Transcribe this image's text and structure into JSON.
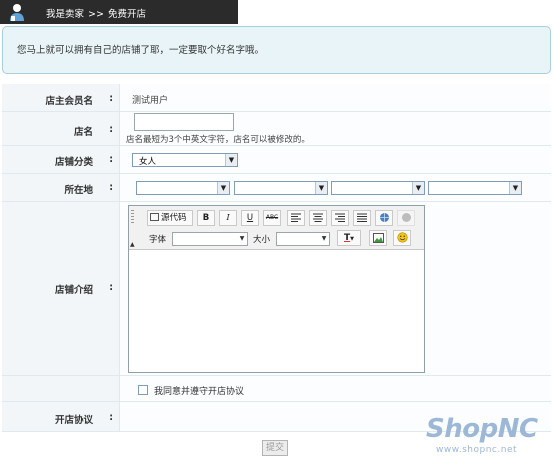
{
  "header": {
    "role": "我是卖家",
    "separator": ">>",
    "page": "免费开店"
  },
  "notice": "您马上就可以拥有自己的店铺了耶，一定要取个好名字哦。",
  "form": {
    "owner": {
      "label": "店主会员名",
      "value": "测试用户"
    },
    "store_name": {
      "label": "店名",
      "value": "",
      "hint": "店名最短为3个中英文字符，店名可以被修改的。"
    },
    "category": {
      "label": "店铺分类",
      "selected": "女人"
    },
    "location": {
      "label": "所在地",
      "selects": [
        "",
        "",
        "",
        ""
      ]
    },
    "intro": {
      "label": "店铺介绍",
      "toolbar": {
        "source_label": "源代码",
        "bold": "B",
        "italic": "I",
        "underline": "U",
        "strike": "ABC",
        "font_label": "字体",
        "size_label": "大小",
        "font_value": "",
        "size_value": ""
      },
      "content": ""
    },
    "agree_label": "我同意并遵守开店协议",
    "agreement_label": "开店协议"
  },
  "submit_label": "提交",
  "brand": {
    "name": "ShopNC",
    "url": "www.shopnc.net"
  },
  "colors": {
    "topbar": "#2b2b2b",
    "notice_bg": "#e9f4f8",
    "label_bg": "#f2f6f8",
    "brand": "#9db8d6"
  }
}
